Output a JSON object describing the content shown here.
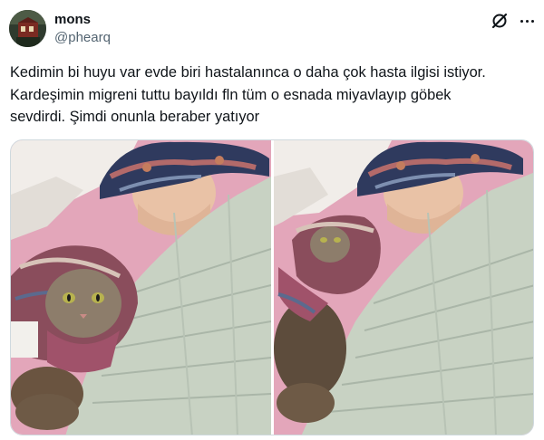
{
  "author": {
    "name": "mons",
    "handle": "@phearq",
    "avatar_icon": "profile-avatar"
  },
  "header_icons": {
    "logo": "grok-x-logo-icon",
    "more": "more-options-icon"
  },
  "tweet": {
    "text": "Kedimin bi huyu var evde biri hastalanınca o daha çok hasta ilgisi istiyor.\nKardeşimin migreni tuttu bayıldı fln tüm o esnada miyavlayıp göbek\nsevdirdi. Şimdi onunla beraber yatıyor"
  },
  "media": {
    "count": 2,
    "photos": [
      "cat-in-headscarf-beside-sleeping-person",
      "cat-in-headscarf-lying-next-to-person"
    ]
  },
  "colors": {
    "text": "#0f1419",
    "secondary": "#536471",
    "border": "#cfd9de",
    "sheet_pink": "#e6a9bd",
    "blanket": "#c9d3c4"
  }
}
